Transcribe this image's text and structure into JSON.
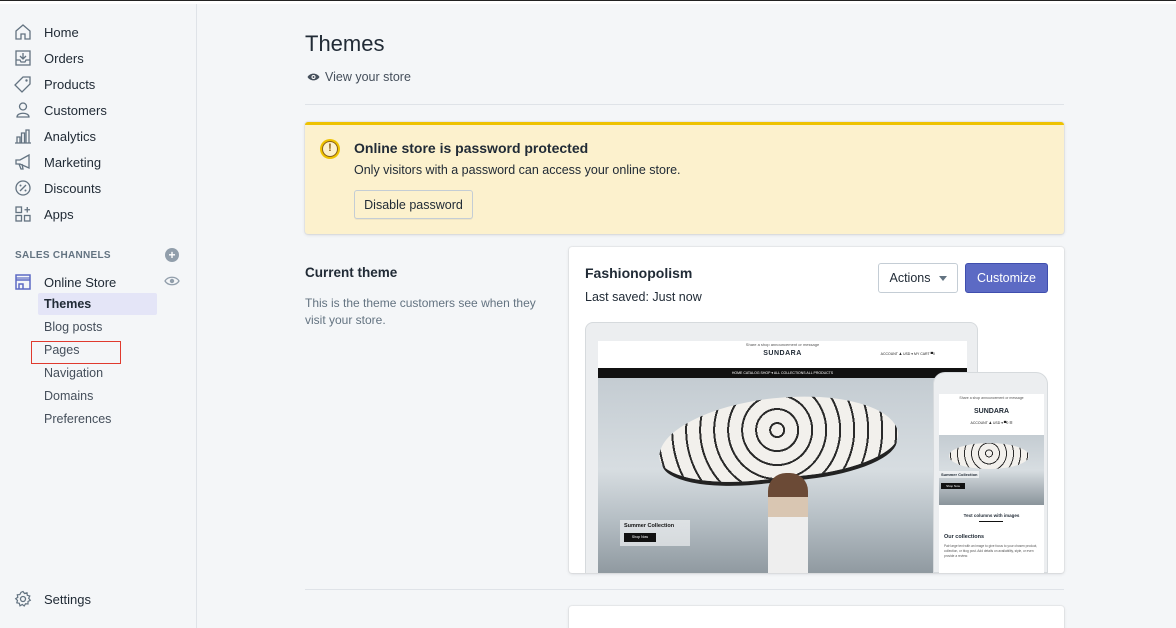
{
  "sidebar": {
    "items": [
      {
        "label": "Home",
        "icon": "home-icon"
      },
      {
        "label": "Orders",
        "icon": "orders-icon"
      },
      {
        "label": "Products",
        "icon": "tag-icon"
      },
      {
        "label": "Customers",
        "icon": "person-icon"
      },
      {
        "label": "Analytics",
        "icon": "bar-chart-icon"
      },
      {
        "label": "Marketing",
        "icon": "megaphone-icon"
      },
      {
        "label": "Discounts",
        "icon": "discount-icon"
      },
      {
        "label": "Apps",
        "icon": "apps-icon"
      }
    ],
    "sales_channels_heading": "SALES CHANNELS",
    "online_store_label": "Online Store",
    "sub_items": [
      {
        "label": "Themes",
        "active": true
      },
      {
        "label": "Blog posts"
      },
      {
        "label": "Pages"
      },
      {
        "label": "Navigation"
      },
      {
        "label": "Domains"
      },
      {
        "label": "Preferences"
      }
    ],
    "settings_label": "Settings"
  },
  "main": {
    "title": "Themes",
    "view_store": "View your store",
    "banner": {
      "title": "Online store is password protected",
      "text": "Only visitors with a password can access your online store.",
      "button": "Disable password",
      "color": "#eec200"
    },
    "current_theme": {
      "heading": "Current theme",
      "description": "This is the theme customers see when they visit your store."
    },
    "theme_card": {
      "name": "Fashionopolism",
      "last_saved": "Last saved: Just now",
      "actions_label": "Actions",
      "customize_label": "Customize",
      "accent": "#5c6ac4"
    },
    "preview": {
      "announcement": "Share a shop announcement or message",
      "brand": "SUNDARA",
      "account": "ACCOUNT ♟ USD ▾    MY CART ▀0",
      "nav": "HOME   CATALOG   SHOP ▾   ALL COLLECTIONS   ALL PRODUCTS",
      "hero_title": "Summer Collection",
      "hero_button": "Shop Now",
      "mobile_icons": "ACCOUNT ♟ USD ▾   ▀0  ☰",
      "mobile_title": "Summer Collection",
      "mobile_button": "Shop Now",
      "text_columns": "Text columns with images",
      "our_collections": "Our collections",
      "collections_desc": "Pair large text with an image to give focus to your chosen product, collection, or blog post. Add details on availability, style, or even provide a review."
    }
  }
}
